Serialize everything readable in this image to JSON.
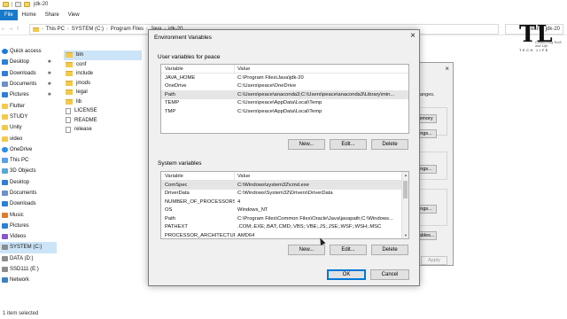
{
  "explorer": {
    "window_title": "jdk-20",
    "ribbon_tabs": [
      "File",
      "Home",
      "Share",
      "View"
    ],
    "breadcrumb": [
      "This PC",
      "SYSTEM (C:)",
      "Program Files",
      "Java",
      "jdk-20"
    ],
    "search_placeholder": "earch jdk-20",
    "nav_items": [
      {
        "label": "Quick access",
        "icon": "star-icon",
        "pinned": false
      },
      {
        "label": "Desktop",
        "icon": "desktop-icon",
        "pinned": true
      },
      {
        "label": "Downloads",
        "icon": "download-icon",
        "pinned": true
      },
      {
        "label": "Documents",
        "icon": "documents-icon",
        "pinned": true
      },
      {
        "label": "Pictures",
        "icon": "pictures-icon",
        "pinned": true
      },
      {
        "label": "Flutter",
        "icon": "folder-icon",
        "pinned": false
      },
      {
        "label": "STUDY",
        "icon": "folder-icon",
        "pinned": false
      },
      {
        "label": "Unity",
        "icon": "folder-icon",
        "pinned": false
      },
      {
        "label": "video",
        "icon": "folder-icon",
        "pinned": false
      },
      {
        "label": "OneDrive",
        "icon": "cloud-icon",
        "pinned": false
      },
      {
        "label": "This PC",
        "icon": "pc-icon",
        "pinned": false
      },
      {
        "label": "3D Objects",
        "icon": "cube-icon",
        "pinned": false
      },
      {
        "label": "Desktop",
        "icon": "desktop-icon",
        "pinned": false
      },
      {
        "label": "Documents",
        "icon": "documents-icon",
        "pinned": false
      },
      {
        "label": "Downloads",
        "icon": "download-icon",
        "pinned": false
      },
      {
        "label": "Music",
        "icon": "music-icon",
        "pinned": false
      },
      {
        "label": "Pictures",
        "icon": "pictures-icon",
        "pinned": false
      },
      {
        "label": "Videos",
        "icon": "video-icon",
        "pinned": false
      },
      {
        "label": "SYSTEM (C:)",
        "icon": "drive-icon",
        "pinned": false,
        "selected": true
      },
      {
        "label": "DATA (D:)",
        "icon": "drive-icon",
        "pinned": false
      },
      {
        "label": "SSD111 (E:)",
        "icon": "drive-icon",
        "pinned": false
      },
      {
        "label": "Network",
        "icon": "network-icon",
        "pinned": false
      }
    ],
    "files": [
      {
        "name": "bin",
        "type": "folder",
        "selected": true
      },
      {
        "name": "conf",
        "type": "folder"
      },
      {
        "name": "include",
        "type": "folder"
      },
      {
        "name": "jmods",
        "type": "folder"
      },
      {
        "name": "legal",
        "type": "folder"
      },
      {
        "name": "lib",
        "type": "folder"
      },
      {
        "name": "LICENSE",
        "type": "file"
      },
      {
        "name": "README",
        "type": "file"
      },
      {
        "name": "release",
        "type": "file"
      }
    ],
    "status": "1 item selected"
  },
  "sysprops": {
    "text": "hanges.",
    "buttons": [
      "emory",
      "ngs...",
      "ngs...",
      "ngs...",
      "iables..."
    ],
    "apply_label": "Apply"
  },
  "logo": {
    "letters": "TL",
    "tagline": "Connecting Tech and Life",
    "brand": "TECH LIFE"
  },
  "env": {
    "title": "Environment Variables",
    "user_section_label": "User variables for peace",
    "system_section_label": "System variables",
    "col_variable": "Variable",
    "col_value": "Value",
    "user_vars": [
      {
        "name": "JAVA_HOME",
        "value": "C:\\Program Files\\Java\\jdk-20"
      },
      {
        "name": "OneDrive",
        "value": "C:\\Users\\peace\\OneDrive"
      },
      {
        "name": "Path",
        "value": "C:\\Users\\peace\\anaconda3;C:\\Users\\peace\\anaconda3\\Library\\min..."
      },
      {
        "name": "TEMP",
        "value": "C:\\Users\\peace\\AppData\\Local\\Temp"
      },
      {
        "name": "TMP",
        "value": "C:\\Users\\peace\\AppData\\Local\\Temp"
      }
    ],
    "system_vars": [
      {
        "name": "ComSpec",
        "value": "C:\\Windows\\system32\\cmd.exe"
      },
      {
        "name": "DriverData",
        "value": "C:\\Windows\\System32\\Drivers\\DriverData"
      },
      {
        "name": "NUMBER_OF_PROCESSORS",
        "value": "4"
      },
      {
        "name": "OS",
        "value": "Windows_NT"
      },
      {
        "name": "Path",
        "value": "C:\\Program Files\\Common Files\\Oracle\\Java\\javapath;C:\\Windows..."
      },
      {
        "name": "PATHEXT",
        "value": ".COM;.EXE;.BAT;.CMD;.VBS;.VBE;.JS;.JSE;.WSF;.WSH;.MSC"
      },
      {
        "name": "PROCESSOR_ARCHITECTURE",
        "value": "AMD64"
      }
    ],
    "new_label": "New...",
    "edit_label": "Edit...",
    "delete_label": "Delete",
    "ok_label": "OK",
    "cancel_label": "Cancel"
  }
}
